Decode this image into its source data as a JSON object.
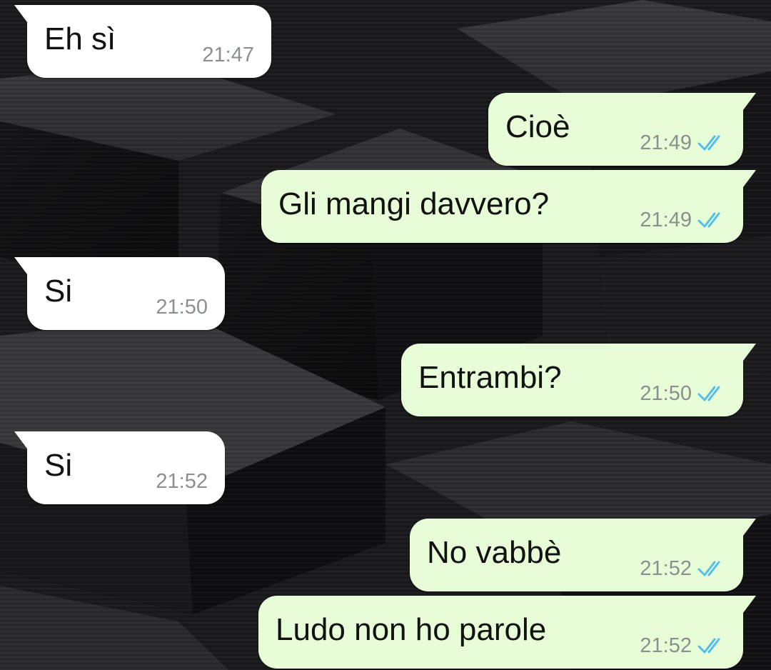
{
  "colors": {
    "incoming_bubble": "#ffffff",
    "outgoing_bubble": "#e7fdd8",
    "message_text": "#111111",
    "timestamp": "#8b8f8e",
    "read_ticks": "#53bdeb",
    "wallpaper": "#1a1a1c"
  },
  "messages": [
    {
      "direction": "incoming",
      "text": "Eh sì",
      "time": "21:47"
    },
    {
      "direction": "outgoing",
      "text": "Cioè",
      "time": "21:49",
      "status_icon": "double-check-read-icon"
    },
    {
      "direction": "outgoing",
      "text": "Gli mangi davvero?",
      "time": "21:49",
      "status_icon": "double-check-read-icon"
    },
    {
      "direction": "incoming",
      "text": "Si",
      "time": "21:50"
    },
    {
      "direction": "outgoing",
      "text": "Entrambi?",
      "time": "21:50",
      "status_icon": "double-check-read-icon"
    },
    {
      "direction": "incoming",
      "text": "Si",
      "time": "21:52"
    },
    {
      "direction": "outgoing",
      "text": "No vabbè",
      "time": "21:52",
      "status_icon": "double-check-read-icon"
    },
    {
      "direction": "outgoing",
      "text": "Ludo non ho parole",
      "time": "21:52",
      "status_icon": "double-check-read-icon"
    }
  ]
}
